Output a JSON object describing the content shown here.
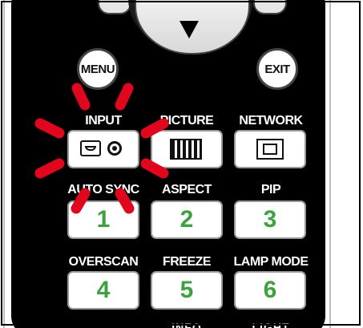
{
  "colors": {
    "remote": "#000000",
    "key_face": "#ffffff",
    "number_green": "#3aa33c",
    "highlight_red": "#e1061b"
  },
  "top_buttons": {
    "menu_label": "MENU",
    "exit_label": "EXIT"
  },
  "rows": [
    {
      "labels": [
        "INPUT",
        "PICTURE",
        "NETWORK"
      ],
      "icons": [
        "input-source-icon",
        "picture-mode-icon",
        "network-icon"
      ]
    },
    {
      "labels": [
        "AUTO SYNC",
        "ASPECT",
        "PIP"
      ],
      "numbers": [
        "1",
        "2",
        "3"
      ]
    },
    {
      "labels": [
        "OVERSCAN",
        "FREEZE",
        "LAMP MODE"
      ],
      "numbers": [
        "4",
        "5",
        "6"
      ]
    }
  ],
  "partial_bottom_labels": [
    "INFO",
    "LIGHT"
  ]
}
